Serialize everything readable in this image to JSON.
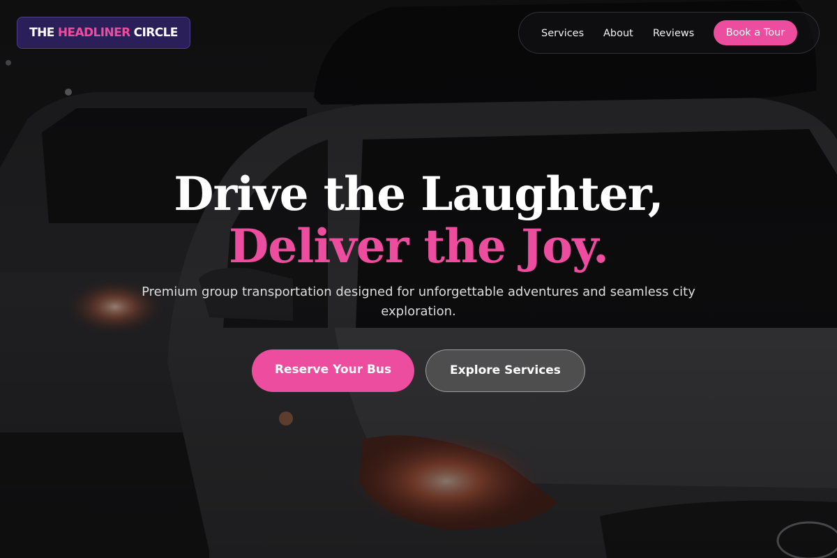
{
  "brand": {
    "logo_word1": "THE",
    "logo_word2": "HEADLINER",
    "logo_word3": "CIRCLE",
    "accent_color": "#ec4d9e",
    "logo_bg_color": "#2a1f58"
  },
  "nav": {
    "links": [
      {
        "label": "Services"
      },
      {
        "label": "About"
      },
      {
        "label": "Reviews"
      }
    ],
    "cta_label": "Book a Tour"
  },
  "hero": {
    "headline_line1": "Drive the Laughter,",
    "headline_line2": "Deliver the Joy.",
    "subtitle": "Premium group transportation designed for unforgettable adventures and seamless city exploration.",
    "primary_button": "Reserve Your Bus",
    "secondary_button": "Explore Services",
    "background_image": "dark-city-taxi-photo"
  }
}
